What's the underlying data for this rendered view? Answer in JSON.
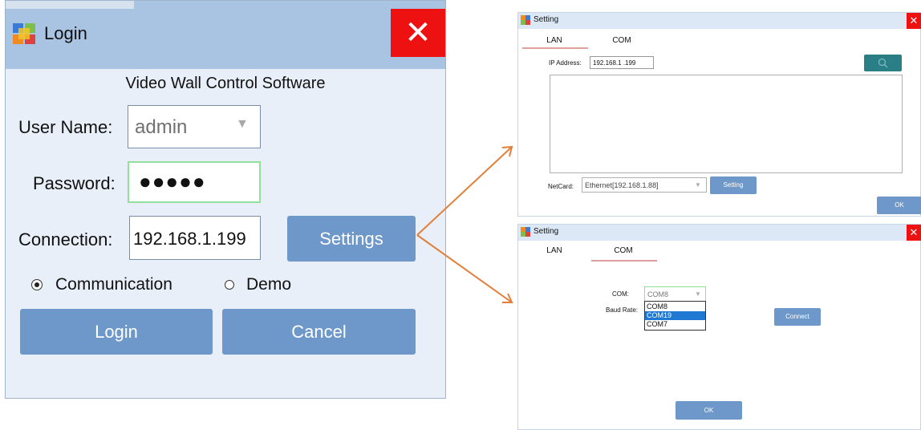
{
  "login": {
    "title": "Login",
    "close": "✕",
    "heading": "Video Wall Control Software",
    "user_label": "User Name:",
    "user_value": "admin",
    "password_label": "Password:",
    "password_value": "●●●●●",
    "connection_label": "Connection:",
    "connection_value": "192.168.1.199",
    "settings_button": "Settings",
    "radio_communication": "Communication",
    "radio_demo": "Demo",
    "selected_mode": "Communication",
    "login_button": "Login",
    "cancel_button": "Cancel"
  },
  "setting_lan": {
    "title": "Setting",
    "tabs": [
      "LAN",
      "COM"
    ],
    "active_tab": "LAN",
    "ip_label": "IP Address:",
    "ip_value": "192.168.1 .199",
    "netcard_label": "NetCard:",
    "netcard_value": "Ethernet[192.168.1.88]",
    "setting_button": "Setting",
    "ok_button": "OK",
    "close": "✕"
  },
  "setting_com": {
    "title": "Setting",
    "tabs": [
      "LAN",
      "COM"
    ],
    "active_tab": "COM",
    "com_label": "COM:",
    "com_value": "COM8",
    "baud_label": "Baud Rate:",
    "com_options": [
      "COM8",
      "COM19",
      "COM7"
    ],
    "highlighted_option": "COM19",
    "connect_button": "Connect",
    "ok_button": "OK",
    "close": "✕"
  },
  "colors": {
    "accent_button": "#6d98c9",
    "close_red": "#ee1111",
    "titlebar": "#a9c3e3",
    "arrow": "#e0803a",
    "search_teal": "#2a7f86"
  }
}
